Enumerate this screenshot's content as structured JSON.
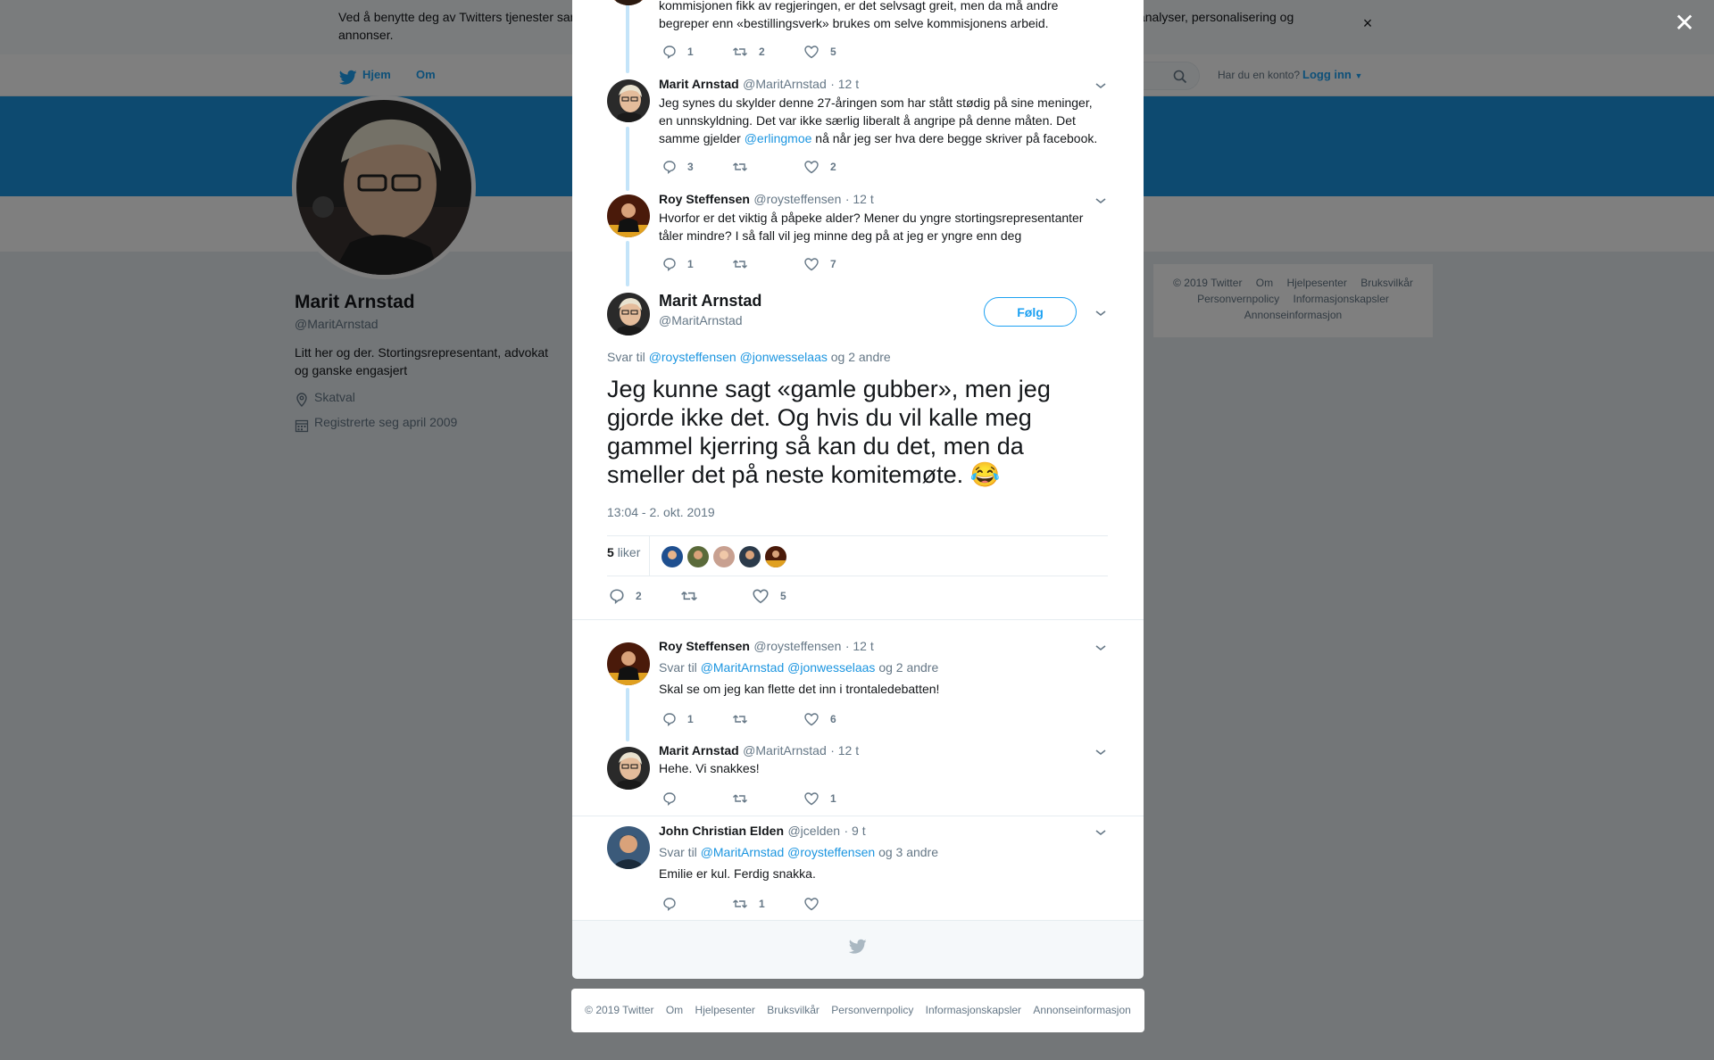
{
  "cookie_banner": {
    "text": "Ved å benytte deg av Twitters tjenester samtykker du i bruk av informasjonskapsler. Twitter og partnerne våre bruker informasjonskapsler til bl.a. analyser, personalisering og annonser.",
    "close_label": "×"
  },
  "nav": {
    "home": "Hjem",
    "about": "Om",
    "have_account": "Har du en konto?",
    "login": "Logg inn"
  },
  "profile": {
    "name": "Marit Arnstad",
    "handle": "@MaritArnstad",
    "bio": "Litt her og der. Stortingsrepresentant, advokat og ganske engasjert",
    "location": "Skatval",
    "joined": "Registrerte seg april 2009"
  },
  "side_footer": {
    "copyright": "© 2019 Twitter",
    "links": [
      "Om",
      "Hjelpesenter",
      "Bruksvilkår",
      "Personvernpolicy",
      "Informasjonskapsler",
      "Annonseinformasjon"
    ]
  },
  "overlay": {
    "close_label": "✕"
  },
  "thread": {
    "top_partial": {
      "text": "kommisjonen fikk av regjeringen, er det selvsagt greit, men da må andre begreper enn «bestillingsverk» brukes om selve kommisjonens arbeid.",
      "replies": "1",
      "retweets": "2",
      "likes": "5"
    },
    "tweet1": {
      "name": "Marit Arnstad",
      "handle": "@MaritArnstad",
      "time": "· 12 t",
      "text_before": "Jeg synes du skylder denne 27-åringen som har stått stødig på sine meninger, en unnskyldning. Det var ikke særlig liberalt å angripe på denne måten. Det samme gjelder ",
      "mention": "@erlingmoe",
      "text_after": " nå når jeg ser hva dere begge skriver på facebook.",
      "replies": "3",
      "retweets": "",
      "likes": "2"
    },
    "tweet2": {
      "name": "Roy Steffensen",
      "handle": "@roysteffensen",
      "time": "· 12 t",
      "text": "Hvorfor er det viktig å påpeke alder? Mener du yngre stortingsrepresentanter tåler mindre? I så fall vil jeg minne deg på at jeg er yngre enn deg",
      "replies": "1",
      "retweets": "",
      "likes": "7"
    },
    "main": {
      "name": "Marit Arnstad",
      "handle": "@MaritArnstad",
      "follow": "Følg",
      "reply_to_label": "Svar til",
      "reply_to_1": "@roysteffensen",
      "reply_to_2": "@jonwesselaas",
      "reply_to_more": "og 2 andre",
      "text": "Jeg kunne sagt «gamle gubber», men jeg gjorde ikke det.  Og hvis du vil kalle meg gammel kjerring så kan du det, men da smeller det på neste komitemøte. 😂",
      "timestamp": "13:04 - 2. okt. 2019",
      "likes_count": "5",
      "likes_label": "liker",
      "replies": "2",
      "retweets": "",
      "likes": "5"
    },
    "reply1": {
      "name": "Roy Steffensen",
      "handle": "@roysteffensen",
      "time": "· 12 t",
      "reply_to_label": "Svar til",
      "reply_to_1": "@MaritArnstad",
      "reply_to_2": "@jonwesselaas",
      "reply_to_more": "og 2 andre",
      "text": "Skal se om jeg kan flette det inn i trontaledebatten!",
      "replies": "1",
      "retweets": "",
      "likes": "6"
    },
    "reply2": {
      "name": "Marit Arnstad",
      "handle": "@MaritArnstad",
      "time": "· 12 t",
      "text": "Hehe. Vi snakkes!",
      "replies": "",
      "retweets": "",
      "likes": "1"
    },
    "reply3": {
      "name": "John Christian Elden",
      "handle": "@jcelden",
      "time": "· 9 t",
      "reply_to_label": "Svar til",
      "reply_to_1": "@MaritArnstad",
      "reply_to_2": "@roysteffensen",
      "reply_to_more": "og 3 andre",
      "text": "Emilie er kul. Ferdig snakka.",
      "replies": "",
      "retweets": "1",
      "likes": ""
    }
  },
  "modal_footer": {
    "copyright": "© 2019 Twitter",
    "links": [
      "Om",
      "Hjelpesenter",
      "Bruksvilkår",
      "Personvernpolicy",
      "Informasjonskapsler",
      "Annonseinformasjon"
    ]
  },
  "colors": {
    "brand": "#1da1f2",
    "link": "#1b95e0",
    "banner": "#1b95e0",
    "muted": "#657786",
    "thread_line": "#c4e4f9"
  },
  "icons": [
    "twitter-bird-icon",
    "search-icon",
    "location-icon",
    "calendar-icon",
    "reply-icon",
    "retweet-icon",
    "like-icon",
    "chevron-down-icon",
    "close-icon"
  ]
}
